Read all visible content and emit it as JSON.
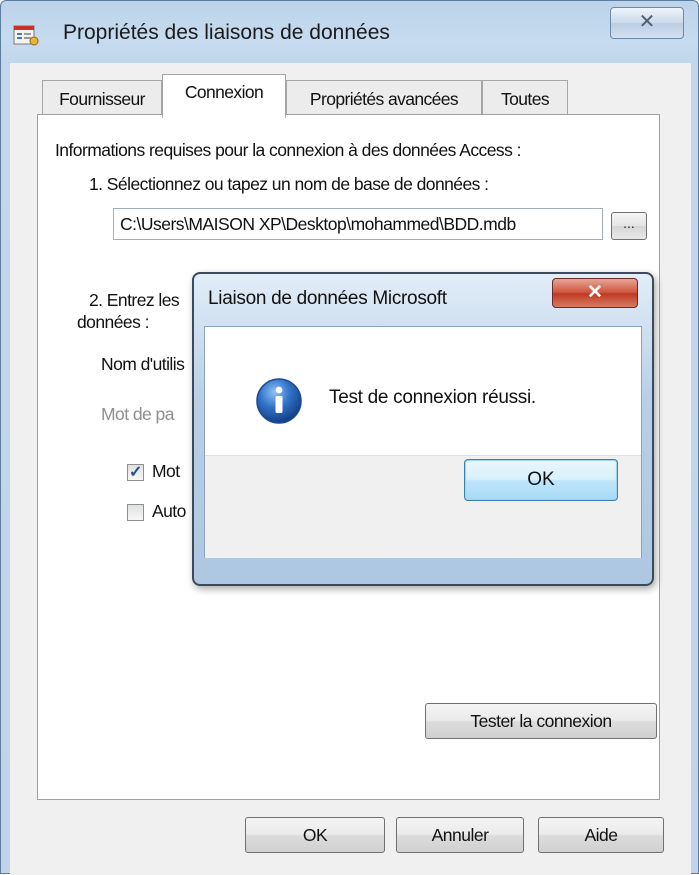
{
  "window": {
    "title": "Propriétés des liaisons de données",
    "close_symbol": "✕",
    "icon": "data-link-properties-icon"
  },
  "tabs": [
    {
      "label": "Fournisseur",
      "active": false
    },
    {
      "label": "Connexion",
      "active": true
    },
    {
      "label": "Propriétés avancées",
      "active": false
    },
    {
      "label": "Toutes",
      "active": false
    }
  ],
  "connection": {
    "info_label": "Informations requises pour la connexion à des données Access :",
    "step1_label": "1. Sélectionnez ou tapez un nom de base de données :",
    "db_path": "C:\\Users\\MAISON XP\\Desktop\\mohammed\\BDD.mdb",
    "browse_label": "...",
    "step2_line1": "2. Entrez les",
    "step2_line2": "données :",
    "username_label": "Nom d'utilis",
    "password_label": "Mot de pa",
    "blank_password_label": "Mot",
    "blank_password_checked": true,
    "allow_save_label": "Auto",
    "allow_save_checked": false,
    "test_button": "Tester la connexion"
  },
  "footer": {
    "ok": "OK",
    "cancel": "Annuler",
    "help": "Aide"
  },
  "message_box": {
    "title": "Liaison de données Microsoft",
    "close_symbol": "✕",
    "icon": "information-icon",
    "text": "Test de connexion réussi.",
    "ok": "OK"
  },
  "colors": {
    "window_frame": "#bfd4ea",
    "msg_close": "#c8452e",
    "info_icon": "#1f5fb5"
  }
}
